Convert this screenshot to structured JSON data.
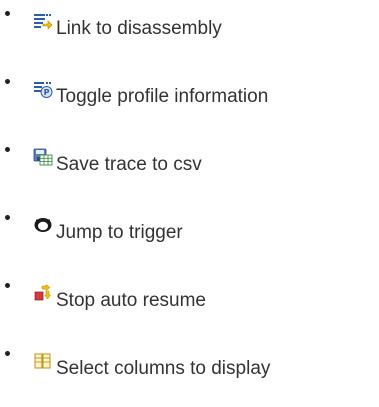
{
  "items": [
    {
      "label": "Link to disassembly",
      "icon": "link-to-disassembly-icon"
    },
    {
      "label": "Toggle profile information",
      "icon": "toggle-profile-icon"
    },
    {
      "label": "Save trace to csv",
      "icon": "save-trace-csv-icon"
    },
    {
      "label": "Jump to trigger",
      "icon": "jump-to-trigger-icon"
    },
    {
      "label": "Stop auto resume",
      "icon": "stop-auto-resume-icon"
    },
    {
      "label": "Select columns to display",
      "icon": "select-columns-icon"
    }
  ],
  "colors": {
    "text": "#333333",
    "bullet": "#222222",
    "icon_blue": "#2a5db0",
    "icon_yellow": "#f2c200",
    "icon_red": "#d8383f",
    "icon_green": "#3a8a3a"
  }
}
